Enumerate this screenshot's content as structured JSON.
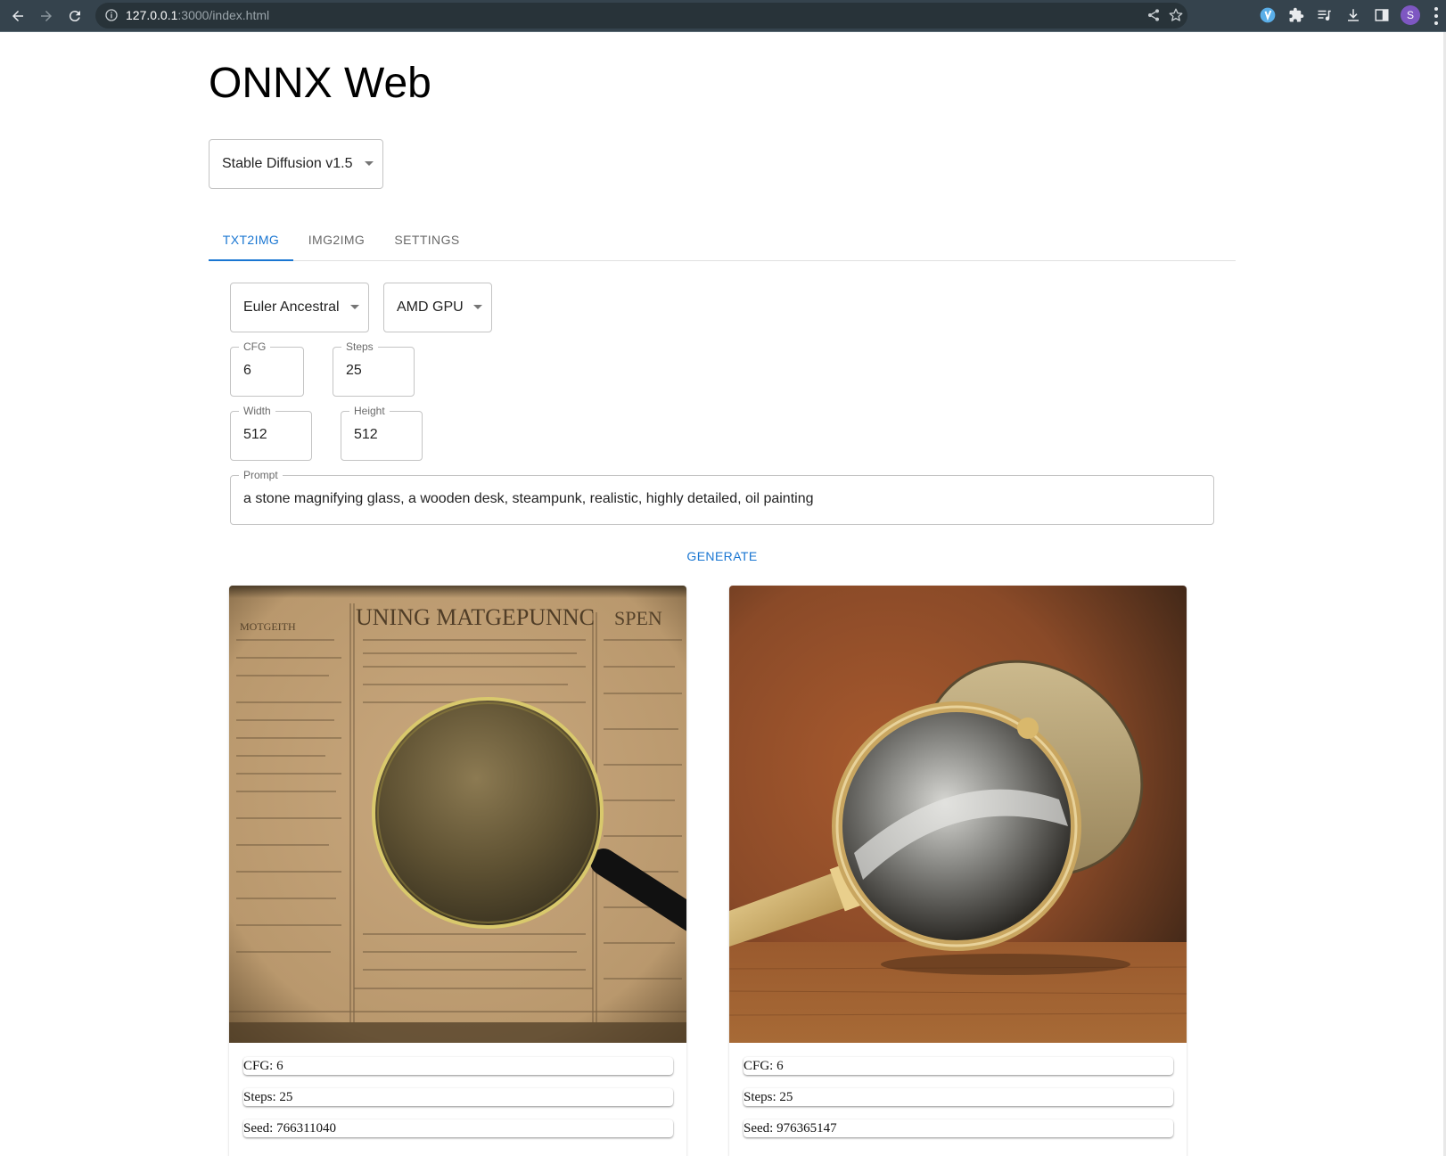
{
  "browser": {
    "url_host": "127.0.0.1",
    "url_rest": ":3000/index.html",
    "profile_initial": "S"
  },
  "app": {
    "title": "ONNX Web",
    "model_select": {
      "value": "Stable Diffusion v1.5"
    }
  },
  "tabs": [
    {
      "label": "TXT2IMG",
      "active": true
    },
    {
      "label": "IMG2IMG",
      "active": false
    },
    {
      "label": "SETTINGS",
      "active": false
    }
  ],
  "form": {
    "scheduler": {
      "value": "Euler Ancestral"
    },
    "platform": {
      "value": "AMD GPU"
    },
    "cfg": {
      "label": "CFG",
      "value": "6"
    },
    "steps": {
      "label": "Steps",
      "value": "25"
    },
    "width": {
      "label": "Width",
      "value": "512"
    },
    "height": {
      "label": "Height",
      "value": "512"
    },
    "prompt": {
      "label": "Prompt",
      "value": "a stone magnifying glass, a wooden desk, steampunk, realistic, highly detailed, oil painting"
    },
    "generate_label": "GENERATE"
  },
  "results": [
    {
      "image_description": "magnifying glass on old newspaper",
      "cfg": "CFG: 6",
      "steps": "Steps: 25",
      "seed": "Seed: 766311040"
    },
    {
      "image_description": "brass magnifying glass on wooden desk, oil painting",
      "cfg": "CFG: 6",
      "steps": "Steps: 25",
      "seed": "Seed: 976365147"
    }
  ],
  "colors": {
    "accent": "#1976d2",
    "chrome_bg": "#35434d",
    "avatar": "#7e57c2"
  }
}
